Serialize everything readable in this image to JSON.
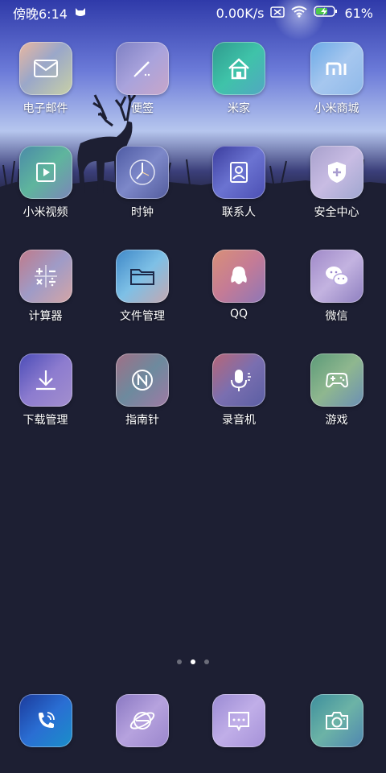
{
  "status_bar": {
    "time": "傍晚6:14",
    "speed": "0.00K/s",
    "battery": "61%"
  },
  "apps": [
    {
      "label": "电子邮件",
      "icon": "mail-icon"
    },
    {
      "label": "便签",
      "icon": "notes-icon"
    },
    {
      "label": "米家",
      "icon": "home-icon"
    },
    {
      "label": "小米商城",
      "icon": "mi-store-icon"
    },
    {
      "label": "小米视频",
      "icon": "video-icon"
    },
    {
      "label": "时钟",
      "icon": "clock-icon"
    },
    {
      "label": "联系人",
      "icon": "contacts-icon"
    },
    {
      "label": "安全中心",
      "icon": "security-icon"
    },
    {
      "label": "计算器",
      "icon": "calculator-icon"
    },
    {
      "label": "文件管理",
      "icon": "folder-icon"
    },
    {
      "label": "QQ",
      "icon": "qq-icon"
    },
    {
      "label": "微信",
      "icon": "wechat-icon"
    },
    {
      "label": "下载管理",
      "icon": "download-icon"
    },
    {
      "label": "指南针",
      "icon": "compass-icon"
    },
    {
      "label": "录音机",
      "icon": "recorder-icon"
    },
    {
      "label": "游戏",
      "icon": "gamepad-icon"
    }
  ],
  "page_indicator": {
    "count": 3,
    "active": 2
  },
  "dock": [
    {
      "icon": "phone-icon"
    },
    {
      "icon": "browser-icon"
    },
    {
      "icon": "messages-icon"
    },
    {
      "icon": "camera-icon"
    }
  ],
  "colors": {
    "background": "#1d1f33",
    "sky_top": "#3b4fb8",
    "sky_mid": "#6e7fd6"
  }
}
